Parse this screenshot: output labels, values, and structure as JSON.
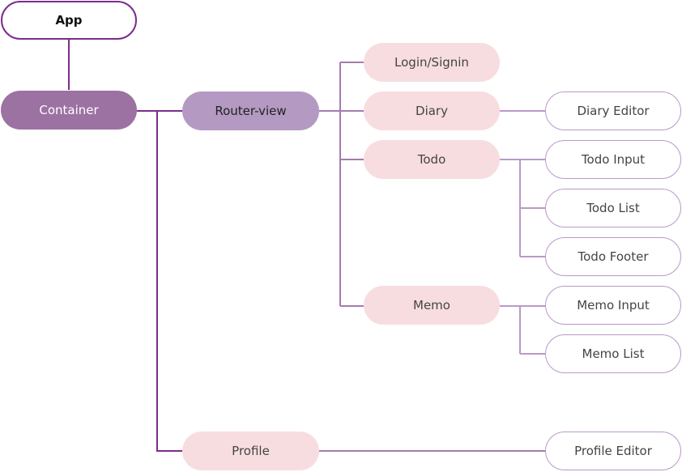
{
  "diagram": {
    "type": "tree",
    "colors": {
      "root_border": "#7b2d8b",
      "container_fill": "#9b72a2",
      "router_fill": "#b49ac2",
      "route_fill": "#f7dde0",
      "leaf_border": "#b99ac6",
      "connector_dark": "#7b2d8b",
      "connector_light": "#a37cad"
    },
    "nodes": {
      "app": "App",
      "container": "Container",
      "router_view": "Router-view",
      "login": "Login/Signin",
      "diary": "Diary",
      "todo": "Todo",
      "memo": "Memo",
      "profile": "Profile",
      "diary_editor": "Diary Editor",
      "todo_input": "Todo Input",
      "todo_list": "Todo List",
      "todo_footer": "Todo Footer",
      "memo_input": "Memo Input",
      "memo_list": "Memo List",
      "profile_editor": "Profile Editor"
    },
    "edges": [
      [
        "App",
        "Container"
      ],
      [
        "Container",
        "Router-view"
      ],
      [
        "Container",
        "Profile"
      ],
      [
        "Router-view",
        "Login/Signin"
      ],
      [
        "Router-view",
        "Diary"
      ],
      [
        "Router-view",
        "Todo"
      ],
      [
        "Router-view",
        "Memo"
      ],
      [
        "Diary",
        "Diary Editor"
      ],
      [
        "Todo",
        "Todo Input"
      ],
      [
        "Todo",
        "Todo List"
      ],
      [
        "Todo",
        "Todo Footer"
      ],
      [
        "Memo",
        "Memo Input"
      ],
      [
        "Memo",
        "Memo List"
      ],
      [
        "Profile",
        "Profile Editor"
      ]
    ]
  }
}
